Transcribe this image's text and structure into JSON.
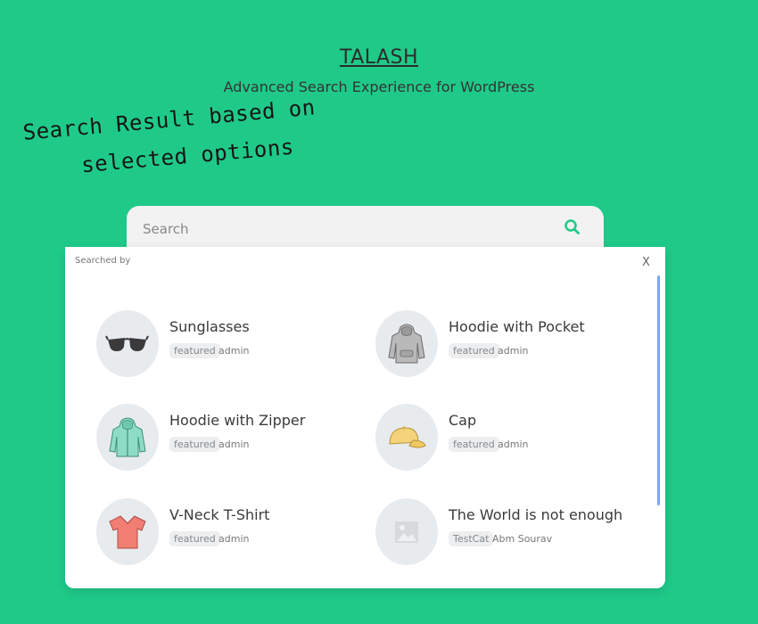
{
  "header": {
    "title": "TALASH",
    "tagline": "Advanced Search Experience for WordPress"
  },
  "annotation": {
    "line1": "Search Result based on",
    "line2": "selected options"
  },
  "search": {
    "placeholder": "Search",
    "button_icon": "search-icon"
  },
  "panel": {
    "searched_by": "Searched by",
    "close_label": "X"
  },
  "results": [
    {
      "title": "Sunglasses",
      "tag": "featured",
      "author": "admin",
      "icon": "sunglasses-icon"
    },
    {
      "title": "Hoodie with Pocket",
      "tag": "featured",
      "author": "admin",
      "icon": "hoodie-pocket-icon"
    },
    {
      "title": "Hoodie with Zipper",
      "tag": "featured",
      "author": "admin",
      "icon": "hoodie-zipper-icon"
    },
    {
      "title": "Cap",
      "tag": "featured",
      "author": "admin",
      "icon": "cap-icon"
    },
    {
      "title": "V-Neck T-Shirt",
      "tag": "featured",
      "author": "admin",
      "icon": "tshirt-icon"
    },
    {
      "title": "The World is not enough",
      "tag": "TestCat",
      "author": "Abm Sourav",
      "icon": "image-placeholder-icon"
    }
  ],
  "colors": {
    "background": "#1fca89",
    "accent": "#1fca89",
    "scrollbar": "#7aa7f4"
  }
}
